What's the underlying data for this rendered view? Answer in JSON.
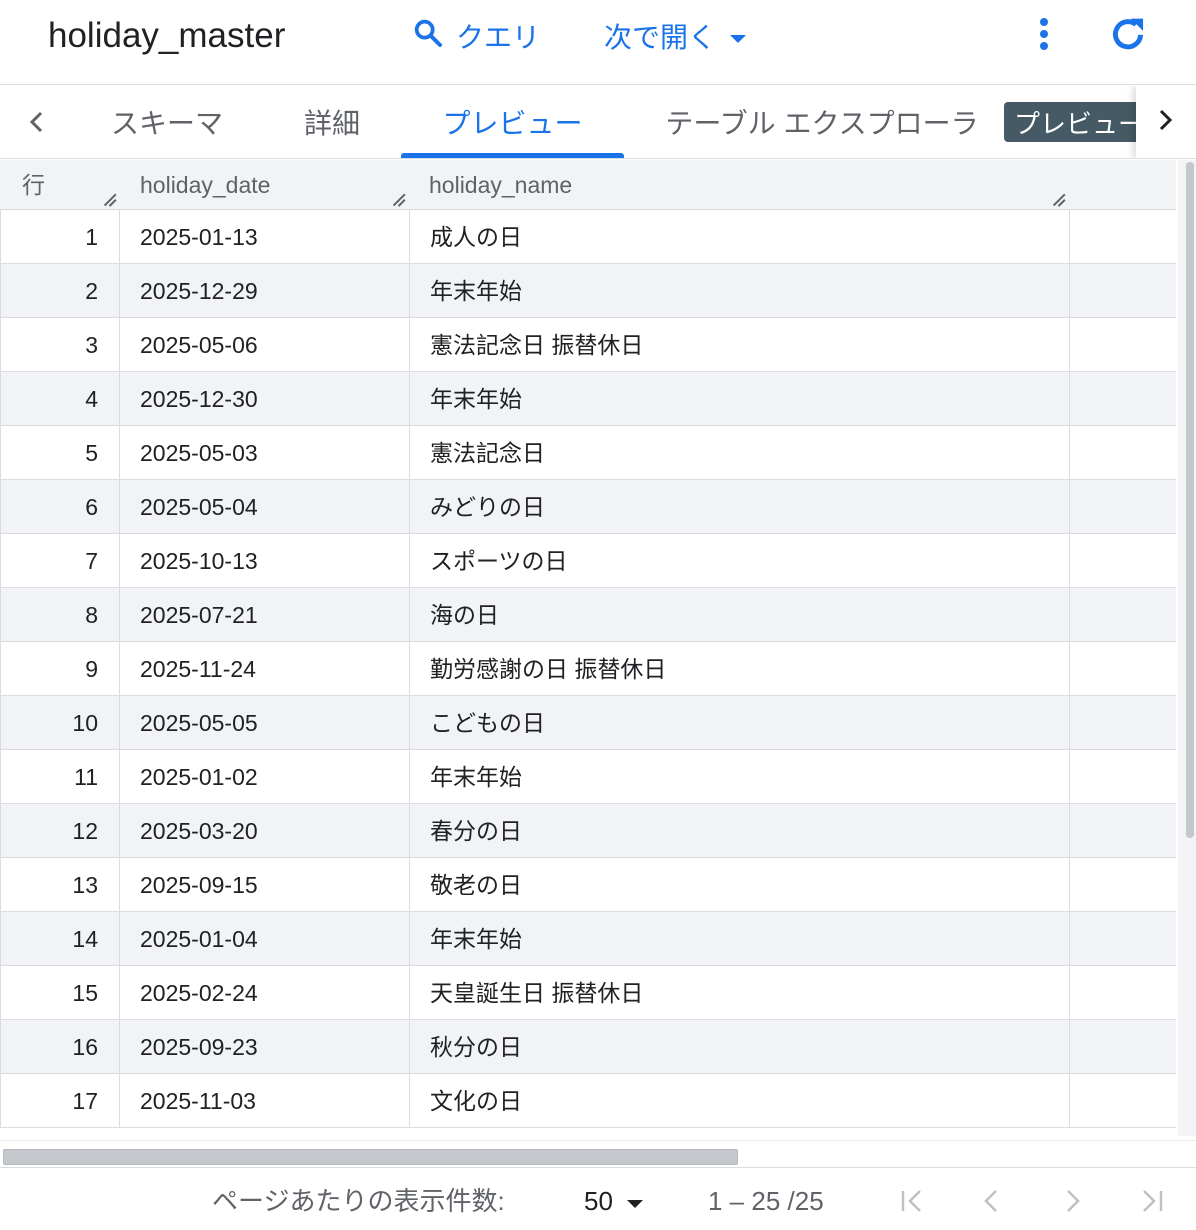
{
  "header": {
    "title": "holiday_master",
    "query_label": "クエリ",
    "open_with_label": "次で開く",
    "accent_color": "#1a73e8"
  },
  "tabs": {
    "items": [
      {
        "label": "スキーマ",
        "active": false
      },
      {
        "label": "詳細",
        "active": false
      },
      {
        "label": "プレビュー",
        "active": true
      },
      {
        "label": "テーブル エクスプローラ",
        "active": false
      }
    ],
    "chip_label": "プレビュー"
  },
  "table": {
    "columns": [
      "行",
      "holiday_date",
      "holiday_name"
    ],
    "rows": [
      {
        "num": "1",
        "date": "2025-01-13",
        "name": "成人の日"
      },
      {
        "num": "2",
        "date": "2025-12-29",
        "name": "年末年始"
      },
      {
        "num": "3",
        "date": "2025-05-06",
        "name": "憲法記念日 振替休日"
      },
      {
        "num": "4",
        "date": "2025-12-30",
        "name": "年末年始"
      },
      {
        "num": "5",
        "date": "2025-05-03",
        "name": "憲法記念日"
      },
      {
        "num": "6",
        "date": "2025-05-04",
        "name": "みどりの日"
      },
      {
        "num": "7",
        "date": "2025-10-13",
        "name": "スポーツの日"
      },
      {
        "num": "8",
        "date": "2025-07-21",
        "name": "海の日"
      },
      {
        "num": "9",
        "date": "2025-11-24",
        "name": "勤労感謝の日 振替休日"
      },
      {
        "num": "10",
        "date": "2025-05-05",
        "name": "こどもの日"
      },
      {
        "num": "11",
        "date": "2025-01-02",
        "name": "年末年始"
      },
      {
        "num": "12",
        "date": "2025-03-20",
        "name": "春分の日"
      },
      {
        "num": "13",
        "date": "2025-09-15",
        "name": "敬老の日"
      },
      {
        "num": "14",
        "date": "2025-01-04",
        "name": "年末年始"
      },
      {
        "num": "15",
        "date": "2025-02-24",
        "name": "天皇誕生日 振替休日"
      },
      {
        "num": "16",
        "date": "2025-09-23",
        "name": "秋分の日"
      },
      {
        "num": "17",
        "date": "2025-11-03",
        "name": "文化の日"
      }
    ]
  },
  "pagination": {
    "per_page_label": "ページあたりの表示件数:",
    "per_page_value": "50",
    "range_text": "1 – 25 /25"
  }
}
